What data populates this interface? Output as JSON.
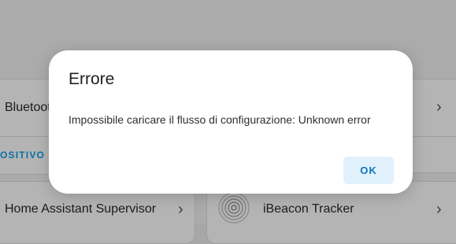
{
  "background": {
    "left_top_card": {
      "label": "Bluetoot",
      "link": "OSITIVO"
    },
    "left_bottom_card": {
      "label": "Home Assistant Supervisor"
    },
    "right_bottom_card": {
      "label": "iBeacon Tracker",
      "icon": "ibeacon-icon"
    },
    "chevron_glyph": "›"
  },
  "dialog": {
    "title": "Errore",
    "message": "Impossibile caricare il flusso di configurazione: Unknown error",
    "ok_label": "OK"
  },
  "colors": {
    "scrim": "#ababab",
    "dialog_bg": "#ffffff",
    "accent": "#0b78b8",
    "button_bg": "#e1f1fb"
  }
}
